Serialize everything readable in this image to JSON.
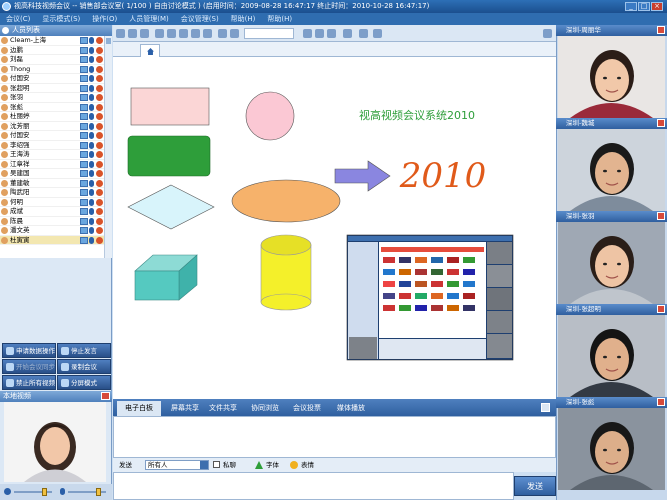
{
  "window": {
    "title": "视高科技视频会议 -- 销售部会议室( 1/100 ) 自由讨论模式 )    (启用时间：2009-08-28 16:47:17   终止时间：2010-10-28 16:47:17)",
    "controls": [
      "_",
      "□",
      "×"
    ]
  },
  "menu": [
    "会议(C)",
    "显示模式(S)",
    "操作(O)",
    "人员管理(M)",
    "会议管理(S)",
    "帮助(H)",
    "帮助(H)"
  ],
  "user_panel": {
    "title": "人员列表",
    "users": [
      "Cleam-上海",
      "边鹏",
      "刘磊",
      "Thong",
      "付国安",
      "张超明",
      "张羽",
      "张彪",
      "杜丽婷",
      "沈芳丽",
      "付国安",
      "李绍强",
      "王海涛",
      "江章祥",
      "吴建国",
      "董建敏",
      "陶武阳",
      "何明",
      "成斌",
      "陈晨",
      "潘文英",
      "杜寅寅"
    ],
    "selected_index": 21
  },
  "left_buttons": [
    {
      "label": "申请数据操作",
      "label2": "停止发言"
    },
    {
      "label": "开始会议同步",
      "label2": "录制会议"
    },
    {
      "label": "禁止所有视频",
      "label2": "分屏模式"
    }
  ],
  "local_video": {
    "title": "本地视频"
  },
  "toolbar": {
    "zoom_value": "",
    "home_tab_icon": "home-icon"
  },
  "whiteboard": {
    "system_text": "视高视频会议系统2010",
    "handwriting": "2010",
    "colors": {
      "rect": "#fbd6d6",
      "green": "#2e9e3a",
      "diamond": "#d8f4fb",
      "circle": "#fbc8d4",
      "arrow": "#8a86e0",
      "ellipse": "#f6b26b",
      "cylinder": "#f4f02a",
      "box": "#55c9c0",
      "handwriting": "#e05a1a",
      "sys_text": "#2e9e3a"
    }
  },
  "bottom_tabs": [
    "电子白板",
    "屏幕共享",
    "文件共享",
    "协同浏览",
    "会议投票",
    "媒体播放"
  ],
  "bottom_active": 0,
  "chat": {
    "to_label": "发送",
    "to_value": "所有人",
    "private_label": "私聊",
    "font_label": "字体",
    "emoticon_label": "表情",
    "send_label": "发送"
  },
  "video_panels": [
    {
      "title": "深圳-周丽华"
    },
    {
      "title": "深圳-魏城"
    },
    {
      "title": "深圳-张羽"
    },
    {
      "title": "深圳-张超明"
    },
    {
      "title": "深圳-张彪"
    }
  ]
}
